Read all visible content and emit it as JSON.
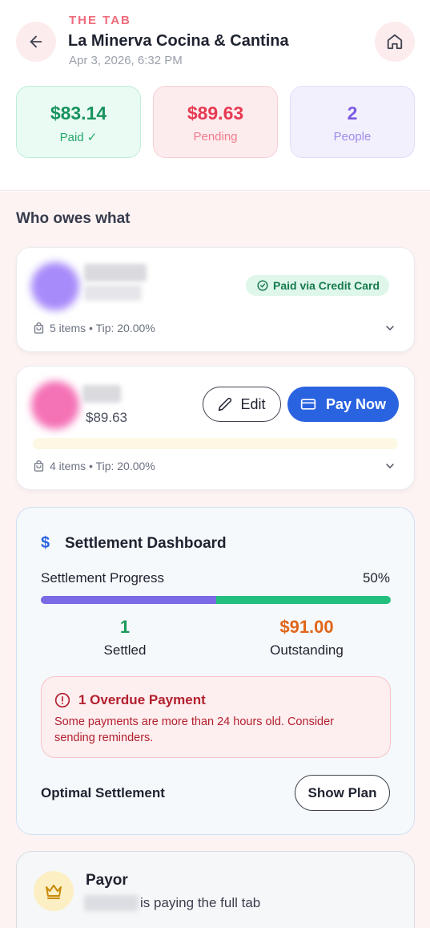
{
  "header": {
    "eyebrow": "THE TAB",
    "title": "La Minerva Cocina & Cantina",
    "datetime": "Apr 3, 2026, 6:32 PM"
  },
  "stats": {
    "paid": {
      "value": "$83.14",
      "label": "Paid ✓"
    },
    "pending": {
      "value": "$89.63",
      "label": "Pending"
    },
    "people": {
      "value": "2",
      "label": "People"
    }
  },
  "section_title": "Who owes what",
  "people": [
    {
      "status_badge": "Paid via Credit Card",
      "items_meta": "5 items • Tip: 20.00%",
      "avatar_color": "#a78bfa"
    },
    {
      "amount": "$89.63",
      "edit_label": "Edit",
      "pay_label": "Pay Now",
      "items_meta": "4 items • Tip: 20.00%",
      "avatar_color": "#f472b6"
    }
  ],
  "settlement": {
    "title": "Settlement Dashboard",
    "progress_label": "Settlement Progress",
    "progress_pct": "50%",
    "progress_fraction": 0.5,
    "settled_count": "1",
    "settled_label": "Settled",
    "outstanding_amount": "$91.00",
    "outstanding_label": "Outstanding",
    "overdue_title": "1 Overdue Payment",
    "overdue_body": "Some payments are more than 24 hours old. Consider sending reminders.",
    "optimal_label": "Optimal Settlement",
    "plan_button": "Show Plan"
  },
  "payor": {
    "title": "Payor",
    "line": "is paying the full tab"
  },
  "colors": {
    "accent": "#2a63e0",
    "paid": "#18935f",
    "pending": "#e63a53",
    "people": "#7c5ae2",
    "outstanding": "#e0661a"
  }
}
